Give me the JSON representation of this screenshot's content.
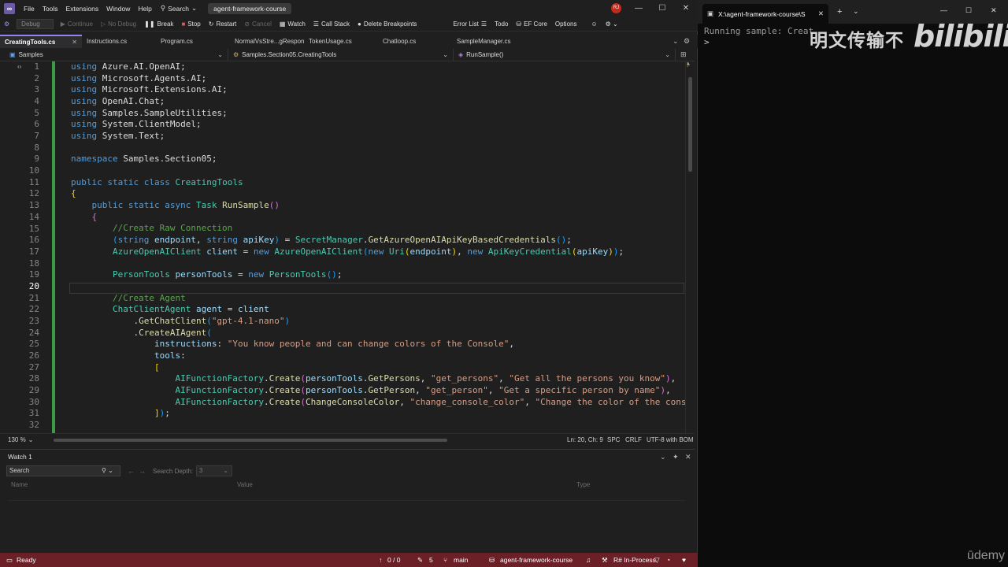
{
  "menubar": {
    "items": [
      "File",
      "Tools",
      "Extensions",
      "Window",
      "Help"
    ],
    "search_label": "Search",
    "solution_name": "agent-framework-course",
    "avatar_initials": "RJ"
  },
  "toolbar": {
    "config": "Debug",
    "continue": "Continue",
    "no_debug": "No Debug",
    "break": "Break",
    "stop": "Stop",
    "restart": "Restart",
    "cancel": "Cancel",
    "watch": "Watch",
    "call_stack": "Call Stack",
    "delete_breakpoints": "Delete Breakpoints",
    "error_list": "Error List",
    "todo": "Todo",
    "ef_core": "EF Core",
    "options": "Options"
  },
  "tabs": [
    {
      "label": "CreatingTools.cs",
      "active": true
    },
    {
      "label": "Instructions.cs",
      "active": false
    },
    {
      "label": "Program.cs",
      "active": false
    },
    {
      "label": "NormalVsStre...gResponse.cs",
      "active": false
    },
    {
      "label": "TokenUsage.cs",
      "active": false
    },
    {
      "label": "Chatloop.cs",
      "active": false
    },
    {
      "label": "SampleManager.cs",
      "active": false
    }
  ],
  "navbar": {
    "project": "Samples",
    "type": "Samples.Section05.CreatingTools",
    "member": "RunSample()"
  },
  "editor": {
    "line_numbers": [
      "1",
      "2",
      "3",
      "4",
      "5",
      "6",
      "7",
      "8",
      "9",
      "10",
      "11",
      "12",
      "13",
      "14",
      "15",
      "16",
      "17",
      "18",
      "19",
      "20",
      "21",
      "22",
      "23",
      "24",
      "25",
      "26",
      "27",
      "28",
      "29",
      "30",
      "31",
      "32"
    ],
    "current_line": "20"
  },
  "editor_status": {
    "zoom": "130 %",
    "position": "Ln: 20, Ch: 9",
    "whitespace": "SPC",
    "line_ending": "CRLF",
    "encoding": "UTF-8 with BOM"
  },
  "watch": {
    "title": "Watch 1",
    "search_placeholder": "Search",
    "search_depth_label": "Search Depth:",
    "search_depth_value": "3",
    "col_name": "Name",
    "col_value": "Value",
    "col_type": "Type"
  },
  "statusbar": {
    "ready": "Ready",
    "errors": "0 / 0",
    "changes": "5",
    "branch": "main",
    "repo": "agent-framework-course",
    "resharper": "R# In-Process"
  },
  "terminal": {
    "tab_title": "X:\\agent-framework-course\\S",
    "line1": "Running sample: Creat",
    "line2": ">"
  },
  "watermarks": {
    "cn_text": "明文传输不",
    "bili": "bilibili",
    "udemy": "ūdemy"
  },
  "colors": {
    "statusbar_bg": "#6b1f26",
    "accent": "#9184ee",
    "keyword": "#569cd6",
    "type": "#4ec9b0",
    "method": "#dcdcaa",
    "string": "#d69d85",
    "comment": "#57a64a"
  }
}
